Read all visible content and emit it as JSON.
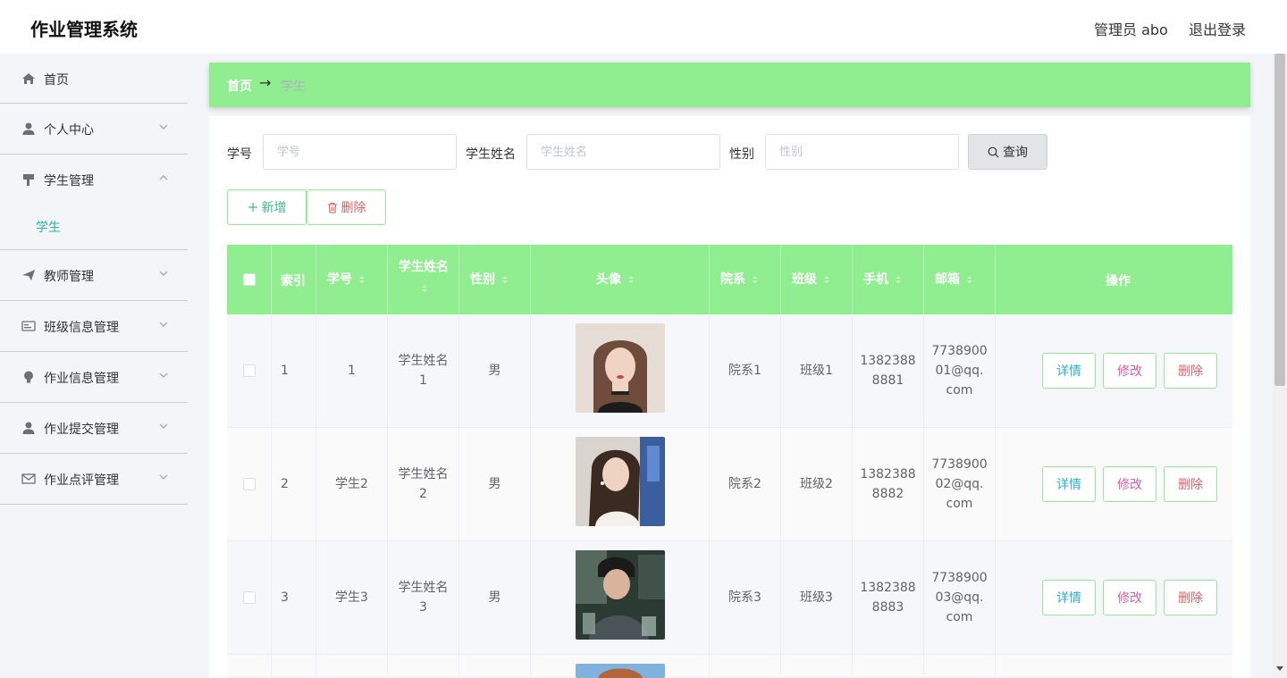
{
  "header": {
    "brand": "作业管理系统",
    "user": "管理员 abo",
    "logout": "退出登录"
  },
  "sidebar": {
    "items": [
      {
        "label": "首页",
        "icon": "home-icon"
      },
      {
        "label": "个人中心",
        "icon": "user-icon"
      },
      {
        "label": "学生管理",
        "icon": "flag-icon"
      },
      {
        "label": "学生",
        "icon": ""
      },
      {
        "label": "教师管理",
        "icon": "send-icon"
      },
      {
        "label": "班级信息管理",
        "icon": "card-icon"
      },
      {
        "label": "作业信息管理",
        "icon": "bulb-icon"
      },
      {
        "label": "作业提交管理",
        "icon": "user-icon"
      },
      {
        "label": "作业点评管理",
        "icon": "mail-icon"
      }
    ]
  },
  "breadcrumb": {
    "home": "首页",
    "arrow": "→",
    "current": "学生"
  },
  "search": {
    "fields": [
      {
        "label": "学号",
        "placeholder": "学号"
      },
      {
        "label": "学生姓名",
        "placeholder": "学生姓名"
      },
      {
        "label": "性别",
        "placeholder": "性别"
      }
    ],
    "query": "查询"
  },
  "actions": {
    "add": "新增",
    "delete": "删除"
  },
  "table": {
    "columns": [
      "索引",
      "学号",
      "学生姓名",
      "性别",
      "头像",
      "院系",
      "班级",
      "手机",
      "邮箱",
      "操作"
    ],
    "rows": [
      {
        "index": "1",
        "xuehao": "1",
        "name_line1": "学生姓名",
        "name_line2": "1",
        "gender": "男",
        "dept": "院系1",
        "class": "班级1",
        "phone_line1": "1382388",
        "phone_line2": "8881",
        "email_line1": "7738900",
        "email_line2": "01@qq.",
        "email_line3": "com"
      },
      {
        "index": "2",
        "xuehao": "学生2",
        "name_line1": "学生姓名",
        "name_line2": "2",
        "gender": "男",
        "dept": "院系2",
        "class": "班级2",
        "phone_line1": "1382388",
        "phone_line2": "8882",
        "email_line1": "7738900",
        "email_line2": "02@qq.",
        "email_line3": "com"
      },
      {
        "index": "3",
        "xuehao": "学生3",
        "name_line1": "学生姓名",
        "name_line2": "3",
        "gender": "男",
        "dept": "院系3",
        "class": "班级3",
        "phone_line1": "1382388",
        "phone_line2": "8883",
        "email_line1": "7738900",
        "email_line2": "03@qq.",
        "email_line3": "com"
      }
    ],
    "ops": {
      "detail": "详情",
      "edit": "修改",
      "delete": "删除"
    }
  },
  "colors": {
    "accent": "#90ee90",
    "active": "#2bb3a6"
  }
}
